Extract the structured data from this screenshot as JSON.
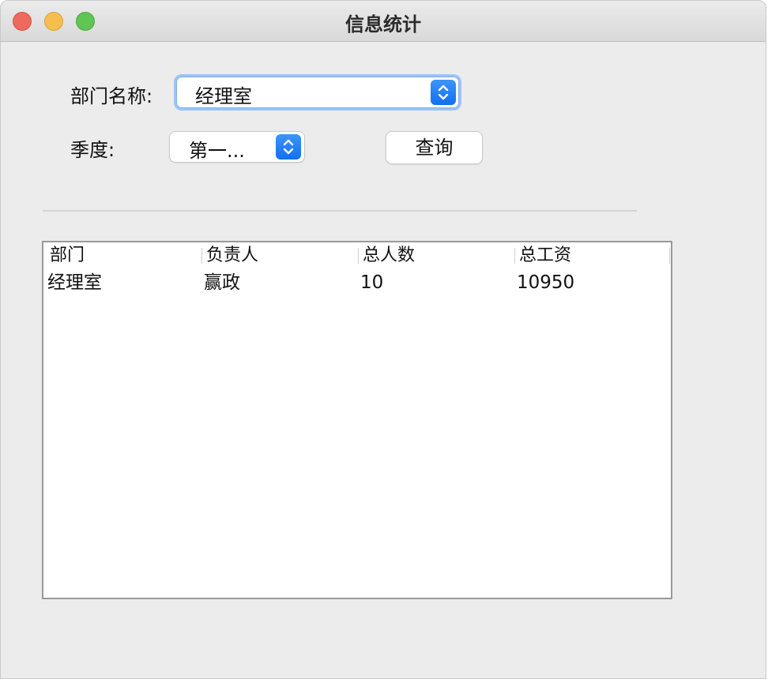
{
  "window": {
    "title": "信息统计"
  },
  "form": {
    "department_label": "部门名称:",
    "department_value": "经理室",
    "quarter_label": "季度:",
    "quarter_value": "第一...",
    "query_button": "查询"
  },
  "table": {
    "columns": [
      "部门",
      "负责人",
      "总人数",
      "总工资"
    ],
    "rows": [
      [
        "经理室",
        "赢政",
        "10",
        "10950"
      ]
    ]
  },
  "colors": {
    "accent": "#1170f0",
    "close": "#ed6a5e",
    "minimize": "#f5bf4f",
    "maximize": "#61c554"
  }
}
